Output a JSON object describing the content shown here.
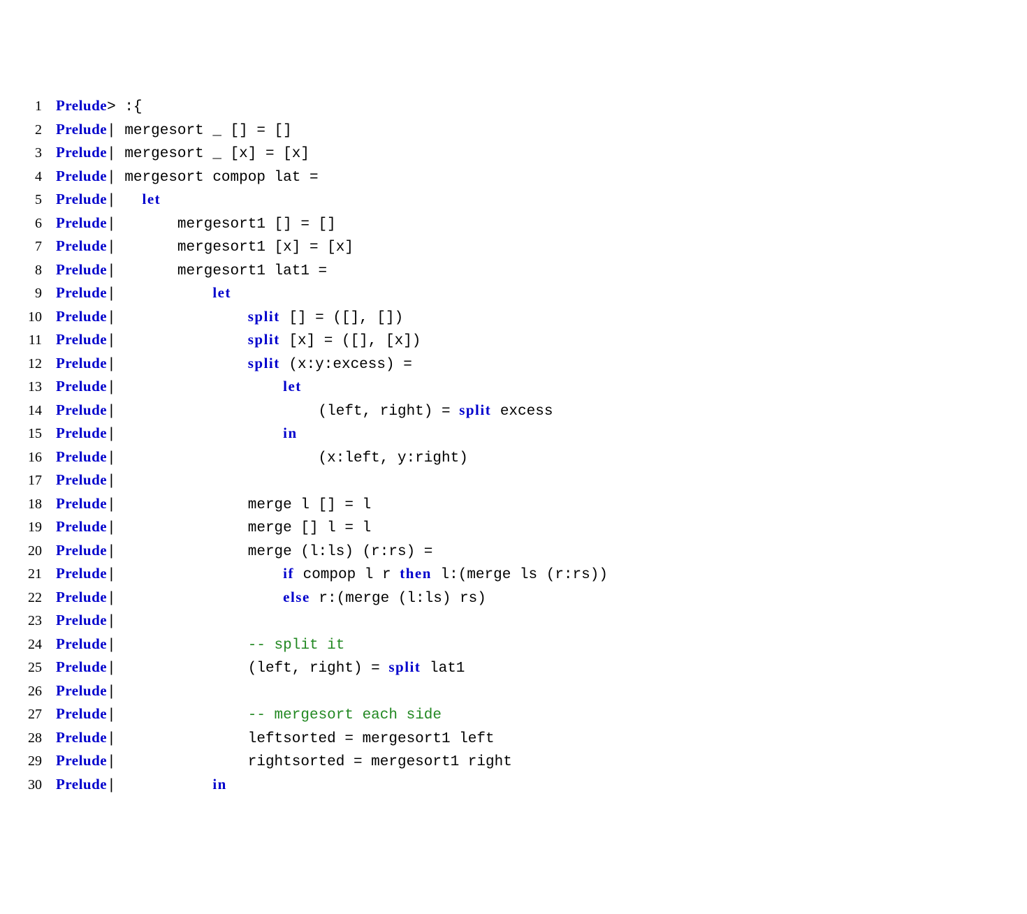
{
  "lines": [
    {
      "n": "1",
      "segments": [
        {
          "cls": "prelude",
          "text": "Prelude"
        },
        {
          "cls": "plain",
          "text": "> :{"
        }
      ]
    },
    {
      "n": "2",
      "segments": [
        {
          "cls": "prelude",
          "text": "Prelude"
        },
        {
          "cls": "plain",
          "text": "| mergesort _ [] = []"
        }
      ]
    },
    {
      "n": "3",
      "segments": [
        {
          "cls": "prelude",
          "text": "Prelude"
        },
        {
          "cls": "plain",
          "text": "| mergesort _ [x] = [x]"
        }
      ]
    },
    {
      "n": "4",
      "segments": [
        {
          "cls": "prelude",
          "text": "Prelude"
        },
        {
          "cls": "plain",
          "text": "| mergesort compop lat ="
        }
      ]
    },
    {
      "n": "5",
      "segments": [
        {
          "cls": "prelude",
          "text": "Prelude"
        },
        {
          "cls": "plain",
          "text": "|   "
        },
        {
          "cls": "keyword",
          "text": "let"
        }
      ]
    },
    {
      "n": "6",
      "segments": [
        {
          "cls": "prelude",
          "text": "Prelude"
        },
        {
          "cls": "plain",
          "text": "|       mergesort1 [] = []"
        }
      ]
    },
    {
      "n": "7",
      "segments": [
        {
          "cls": "prelude",
          "text": "Prelude"
        },
        {
          "cls": "plain",
          "text": "|       mergesort1 [x] = [x]"
        }
      ]
    },
    {
      "n": "8",
      "segments": [
        {
          "cls": "prelude",
          "text": "Prelude"
        },
        {
          "cls": "plain",
          "text": "|       mergesort1 lat1 ="
        }
      ]
    },
    {
      "n": "9",
      "segments": [
        {
          "cls": "prelude",
          "text": "Prelude"
        },
        {
          "cls": "plain",
          "text": "|           "
        },
        {
          "cls": "keyword",
          "text": "let"
        }
      ]
    },
    {
      "n": "10",
      "segments": [
        {
          "cls": "prelude",
          "text": "Prelude"
        },
        {
          "cls": "plain",
          "text": "|               "
        },
        {
          "cls": "keyword",
          "text": "split"
        },
        {
          "cls": "plain",
          "text": " [] = ([], [])"
        }
      ]
    },
    {
      "n": "11",
      "segments": [
        {
          "cls": "prelude",
          "text": "Prelude"
        },
        {
          "cls": "plain",
          "text": "|               "
        },
        {
          "cls": "keyword",
          "text": "split"
        },
        {
          "cls": "plain",
          "text": " [x] = ([], [x])"
        }
      ]
    },
    {
      "n": "12",
      "segments": [
        {
          "cls": "prelude",
          "text": "Prelude"
        },
        {
          "cls": "plain",
          "text": "|               "
        },
        {
          "cls": "keyword",
          "text": "split"
        },
        {
          "cls": "plain",
          "text": " (x:y:excess) ="
        }
      ]
    },
    {
      "n": "13",
      "segments": [
        {
          "cls": "prelude",
          "text": "Prelude"
        },
        {
          "cls": "plain",
          "text": "|                   "
        },
        {
          "cls": "keyword",
          "text": "let"
        }
      ]
    },
    {
      "n": "14",
      "segments": [
        {
          "cls": "prelude",
          "text": "Prelude"
        },
        {
          "cls": "plain",
          "text": "|                       (left, right) = "
        },
        {
          "cls": "keyword",
          "text": "split"
        },
        {
          "cls": "plain",
          "text": " excess"
        }
      ]
    },
    {
      "n": "15",
      "segments": [
        {
          "cls": "prelude",
          "text": "Prelude"
        },
        {
          "cls": "plain",
          "text": "|                   "
        },
        {
          "cls": "keyword",
          "text": "in"
        }
      ]
    },
    {
      "n": "16",
      "segments": [
        {
          "cls": "prelude",
          "text": "Prelude"
        },
        {
          "cls": "plain",
          "text": "|                       (x:left, y:right)"
        }
      ]
    },
    {
      "n": "17",
      "segments": [
        {
          "cls": "prelude",
          "text": "Prelude"
        },
        {
          "cls": "plain",
          "text": "|"
        }
      ]
    },
    {
      "n": "18",
      "segments": [
        {
          "cls": "prelude",
          "text": "Prelude"
        },
        {
          "cls": "plain",
          "text": "|               merge l [] = l"
        }
      ]
    },
    {
      "n": "19",
      "segments": [
        {
          "cls": "prelude",
          "text": "Prelude"
        },
        {
          "cls": "plain",
          "text": "|               merge [] l = l"
        }
      ]
    },
    {
      "n": "20",
      "segments": [
        {
          "cls": "prelude",
          "text": "Prelude"
        },
        {
          "cls": "plain",
          "text": "|               merge (l:ls) (r:rs) ="
        }
      ]
    },
    {
      "n": "21",
      "segments": [
        {
          "cls": "prelude",
          "text": "Prelude"
        },
        {
          "cls": "plain",
          "text": "|                   "
        },
        {
          "cls": "keyword",
          "text": "if"
        },
        {
          "cls": "plain",
          "text": " compop l r "
        },
        {
          "cls": "keyword",
          "text": "then"
        },
        {
          "cls": "plain",
          "text": " l:(merge ls (r:rs))"
        }
      ]
    },
    {
      "n": "22",
      "segments": [
        {
          "cls": "prelude",
          "text": "Prelude"
        },
        {
          "cls": "plain",
          "text": "|                   "
        },
        {
          "cls": "keyword",
          "text": "else"
        },
        {
          "cls": "plain",
          "text": " r:(merge (l:ls) rs)"
        }
      ]
    },
    {
      "n": "23",
      "segments": [
        {
          "cls": "prelude",
          "text": "Prelude"
        },
        {
          "cls": "plain",
          "text": "|"
        }
      ]
    },
    {
      "n": "24",
      "segments": [
        {
          "cls": "prelude",
          "text": "Prelude"
        },
        {
          "cls": "plain",
          "text": "|               "
        },
        {
          "cls": "comment",
          "text": "-- split it"
        }
      ]
    },
    {
      "n": "25",
      "segments": [
        {
          "cls": "prelude",
          "text": "Prelude"
        },
        {
          "cls": "plain",
          "text": "|               (left, right) = "
        },
        {
          "cls": "keyword",
          "text": "split"
        },
        {
          "cls": "plain",
          "text": " lat1"
        }
      ]
    },
    {
      "n": "26",
      "segments": [
        {
          "cls": "prelude",
          "text": "Prelude"
        },
        {
          "cls": "plain",
          "text": "|"
        }
      ]
    },
    {
      "n": "27",
      "segments": [
        {
          "cls": "prelude",
          "text": "Prelude"
        },
        {
          "cls": "plain",
          "text": "|               "
        },
        {
          "cls": "comment",
          "text": "-- mergesort each side"
        }
      ]
    },
    {
      "n": "28",
      "segments": [
        {
          "cls": "prelude",
          "text": "Prelude"
        },
        {
          "cls": "plain",
          "text": "|               leftsorted = mergesort1 left"
        }
      ]
    },
    {
      "n": "29",
      "segments": [
        {
          "cls": "prelude",
          "text": "Prelude"
        },
        {
          "cls": "plain",
          "text": "|               rightsorted = mergesort1 right"
        }
      ]
    },
    {
      "n": "30",
      "segments": [
        {
          "cls": "prelude",
          "text": "Prelude"
        },
        {
          "cls": "plain",
          "text": "|           "
        },
        {
          "cls": "keyword",
          "text": "in"
        }
      ]
    }
  ]
}
